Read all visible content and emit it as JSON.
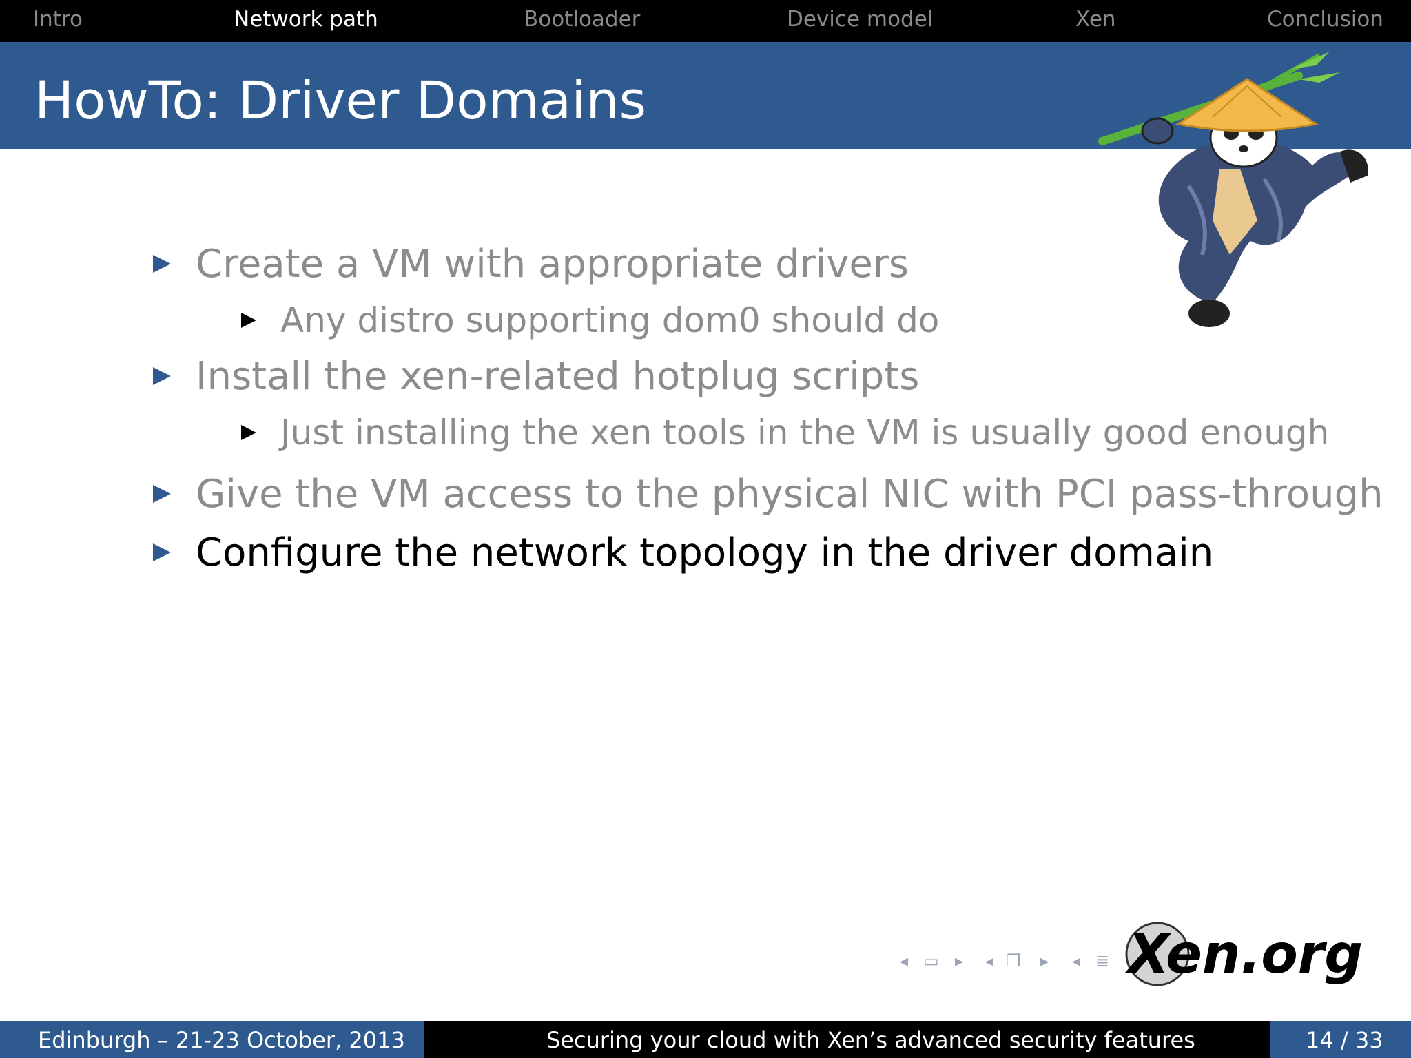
{
  "nav": {
    "items": [
      "Intro",
      "Network path",
      "Bootloader",
      "Device model",
      "Xen",
      "Conclusion"
    ],
    "active": "Network path"
  },
  "slide": {
    "title": "HowTo: Driver Domains",
    "bullets": [
      {
        "level": 1,
        "text": "Create a VM with appropriate drivers",
        "style": "gray"
      },
      {
        "level": 2,
        "text": "Any distro supporting dom0 should do",
        "style": "gray"
      },
      {
        "level": 1,
        "text": "Install the xen-related hotplug scripts",
        "style": "gray"
      },
      {
        "level": 2,
        "text": "Just installing the xen tools in the VM is usually good enough",
        "style": "gray"
      },
      {
        "level": 1,
        "text": "Give the VM access to the physical NIC with PCI pass-through",
        "style": "gray"
      },
      {
        "level": 1,
        "text": "Configure the network topology in the driver domain",
        "style": "dark"
      }
    ]
  },
  "logo": {
    "text": "Xen.org"
  },
  "footer": {
    "left": "Edinburgh – 21-23 October, 2013",
    "center": "Securing your cloud with Xen’s advanced security features",
    "right": "14 / 33"
  },
  "colors": {
    "accent": "#2f5a8f",
    "gray_text": "#8c8c8c",
    "bar": "#000000"
  }
}
